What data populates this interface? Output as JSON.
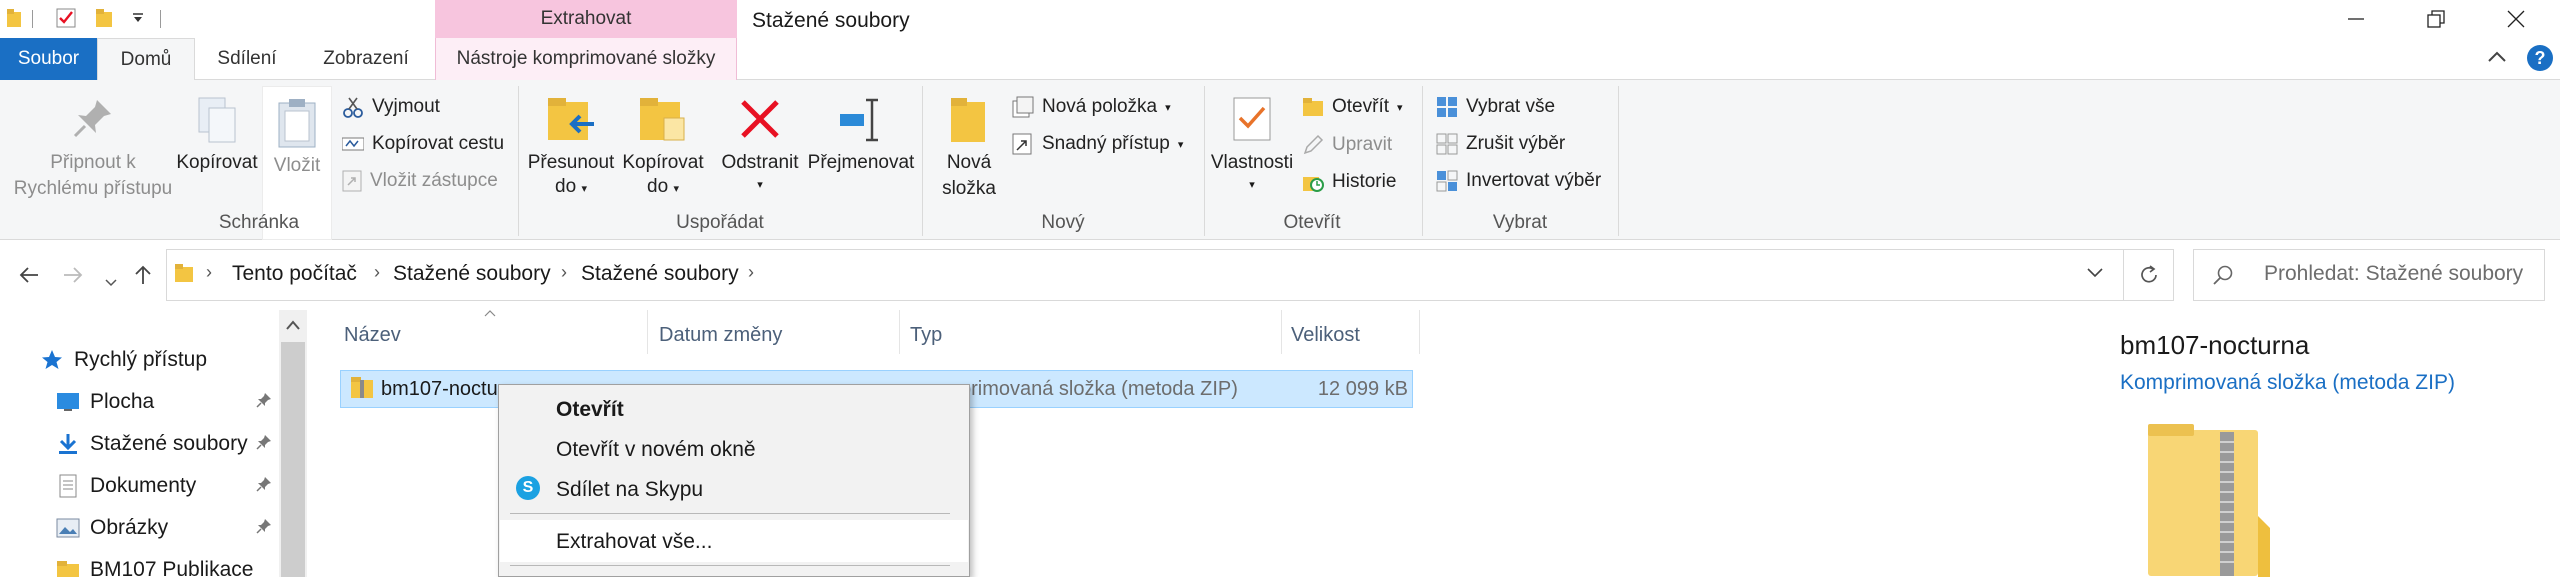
{
  "titlebar": {
    "context_tab": "Extrahovat",
    "window_title": "Stažené soubory",
    "buttons": [
      "—",
      "❐",
      "✕"
    ]
  },
  "tabs": {
    "file": "Soubor",
    "home": "Domů",
    "share": "Sdílení",
    "view": "Zobrazení",
    "context": "Nástroje komprimované složky"
  },
  "ribbon": {
    "clipboard": {
      "group": "Schránka",
      "pin_line1": "Připnout k",
      "pin_line2": "Rychlému přístupu",
      "copy": "Kopírovat",
      "paste": "Vložit",
      "cut": "Vyjmout",
      "copy_path": "Kopírovat cestu",
      "paste_shortcut": "Vložit zástupce"
    },
    "organize": {
      "group": "Uspořádat",
      "move_line1": "Přesunout",
      "move_line2": "do",
      "copy_line1": "Kopírovat",
      "copy_line2": "do",
      "delete": "Odstranit",
      "rename": "Přejmenovat"
    },
    "new": {
      "group": "Nový",
      "folder_line1": "Nová",
      "folder_line2": "složka",
      "new_item": "Nová položka",
      "easy_access": "Snadný přístup"
    },
    "open": {
      "group": "Otevřít",
      "properties": "Vlastnosti",
      "open": "Otevřít",
      "edit": "Upravit",
      "history": "Historie"
    },
    "select": {
      "group": "Vybrat",
      "select_all": "Vybrat vše",
      "select_none": "Zrušit výběr",
      "invert": "Invertovat výběr"
    }
  },
  "address": {
    "crumbs": [
      "Tento počítač",
      "Stažené soubory",
      "Stažené soubory"
    ],
    "search_placeholder": "Prohledat: Stažené soubory"
  },
  "navpane": {
    "items": [
      {
        "label": "Rychlý přístup",
        "icon": "star-icon",
        "pinned": false
      },
      {
        "label": "Plocha",
        "icon": "desktop-icon",
        "pinned": true
      },
      {
        "label": "Stažené soubory",
        "icon": "download-icon",
        "pinned": true
      },
      {
        "label": "Dokumenty",
        "icon": "documents-icon",
        "pinned": true
      },
      {
        "label": "Obrázky",
        "icon": "pictures-icon",
        "pinned": true
      },
      {
        "label": "BM107 Publikace",
        "icon": "folder-icon",
        "pinned": false
      }
    ]
  },
  "filelist": {
    "columns": [
      "Název",
      "Datum změny",
      "Typ",
      "Velikost"
    ],
    "rows": [
      {
        "name": "bm107-noctu",
        "type_visible": "primovaná složka (metoda ZIP)",
        "size": "12 099 kB"
      }
    ]
  },
  "context_menu": {
    "items": [
      "Otevřít",
      "Otevřít v novém okně",
      "Sdílet na Skypu",
      "Extrahovat vše..."
    ]
  },
  "preview": {
    "title": "bm107-nocturna",
    "subtitle": "Komprimovaná složka (metoda ZIP)"
  },
  "colors": {
    "accent": "#1a6fc4",
    "context_tab": "#f7c5de",
    "selection": "#cce8ff",
    "folder": "#f3c542",
    "delete": "#e81123"
  }
}
